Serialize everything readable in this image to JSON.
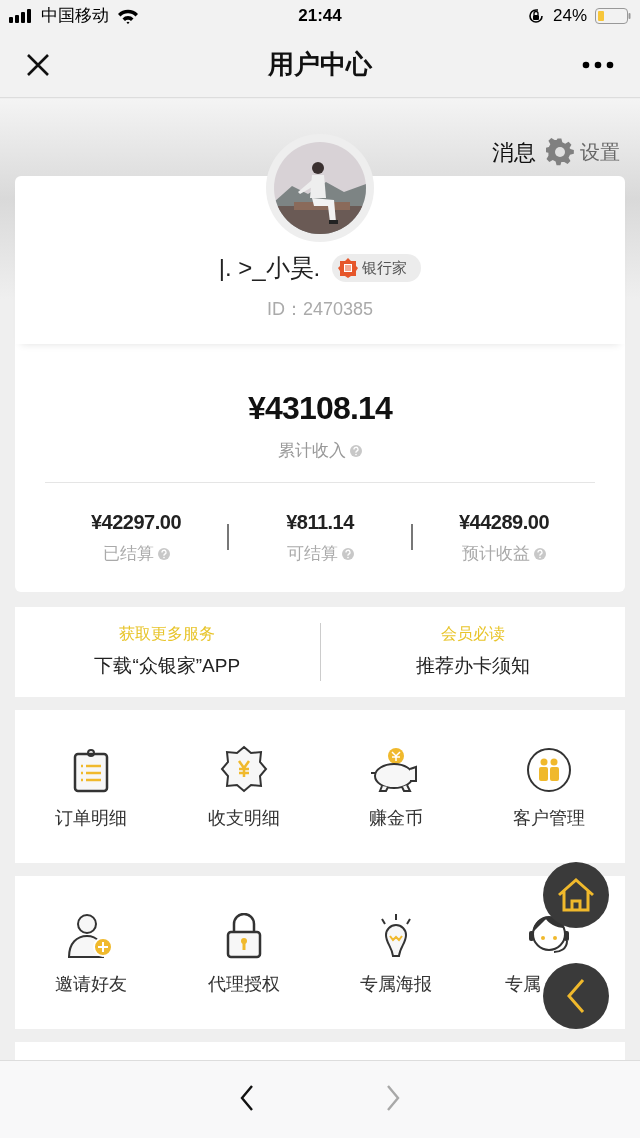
{
  "status_bar": {
    "carrier": "中国移动",
    "time": "21:44",
    "battery": "24%"
  },
  "nav_bar": {
    "title": "用户中心"
  },
  "header_links": {
    "messages": "消息",
    "settings": "设置"
  },
  "profile": {
    "name": "|. >_小昊.",
    "badge": "银行家",
    "id": "ID：2470385"
  },
  "earnings": {
    "total": "¥43108.14",
    "total_label": "累计收入",
    "stats": [
      {
        "value": "¥42297.00",
        "label": "已结算"
      },
      {
        "value": "¥811.14",
        "label": "可结算"
      },
      {
        "value": "¥44289.00",
        "label": "预计收益"
      }
    ]
  },
  "promos": [
    {
      "caption": "获取更多服务",
      "title": "下载“众银家”APP"
    },
    {
      "caption": "会员必读",
      "title": "推荐办卡须知"
    }
  ],
  "grids": [
    [
      {
        "kind": "clipboard",
        "label": "订单明细"
      },
      {
        "kind": "badge",
        "label": "收支明细"
      },
      {
        "kind": "piggy",
        "label": "赚金币"
      },
      {
        "kind": "people",
        "label": "客户管理"
      }
    ],
    [
      {
        "kind": "user-add",
        "label": "邀请好友"
      },
      {
        "kind": "lock",
        "label": "代理授权"
      },
      {
        "kind": "bulb",
        "label": "专属海报"
      },
      {
        "kind": "headset",
        "label": "专属"
      }
    ]
  ],
  "bottom_toolbar": [
    {
      "kind": "back",
      "disabled": false
    },
    {
      "kind": "forward",
      "disabled": true
    }
  ]
}
